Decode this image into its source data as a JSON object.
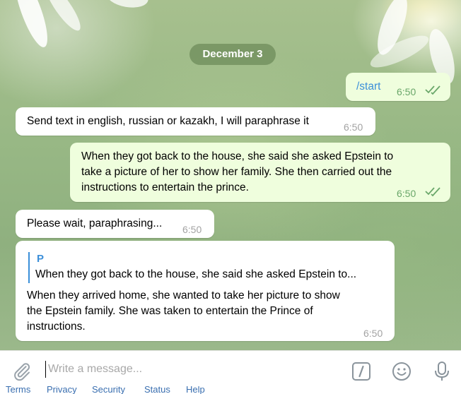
{
  "chat": {
    "date_label": "December 3",
    "messages": [
      {
        "direction": "out",
        "text": "/start",
        "time": "6:50",
        "status": "read"
      },
      {
        "direction": "in",
        "text": "Send text in english, russian or kazakh, I will paraphrase it",
        "time": "6:50"
      },
      {
        "direction": "out",
        "lines": [
          "When they got back to the house, she said she asked Epstein to",
          "take a picture of her to show her family. She then carried out the",
          "instructions to entertain the prince."
        ],
        "time": "6:50",
        "status": "read"
      },
      {
        "direction": "in",
        "text": "Please wait, paraphrasing...",
        "time": "6:50"
      },
      {
        "direction": "in",
        "reply": {
          "author": "P",
          "text": "When they got back to the house, she said she asked Epstein to..."
        },
        "lines": [
          "When they arrived home, she wanted to take her picture to show",
          "the Epstein family. She was taken to entertain the Prince of",
          "instructions."
        ],
        "time": "6:50"
      }
    ]
  },
  "composer": {
    "placeholder": "Write a message...",
    "value": "",
    "icons": [
      "paperclip-icon",
      "command-icon",
      "emoji-icon",
      "microphone-icon"
    ]
  },
  "footer": {
    "links": [
      "Terms",
      "Privacy",
      "Security",
      "Status",
      "Help"
    ]
  },
  "colors": {
    "outgoing_bubble": "#effedd",
    "incoming_bubble": "#ffffff",
    "link_accent": "#3b8fd9",
    "check_green": "#6aa76a",
    "date_pill": "#6e8c5a"
  }
}
